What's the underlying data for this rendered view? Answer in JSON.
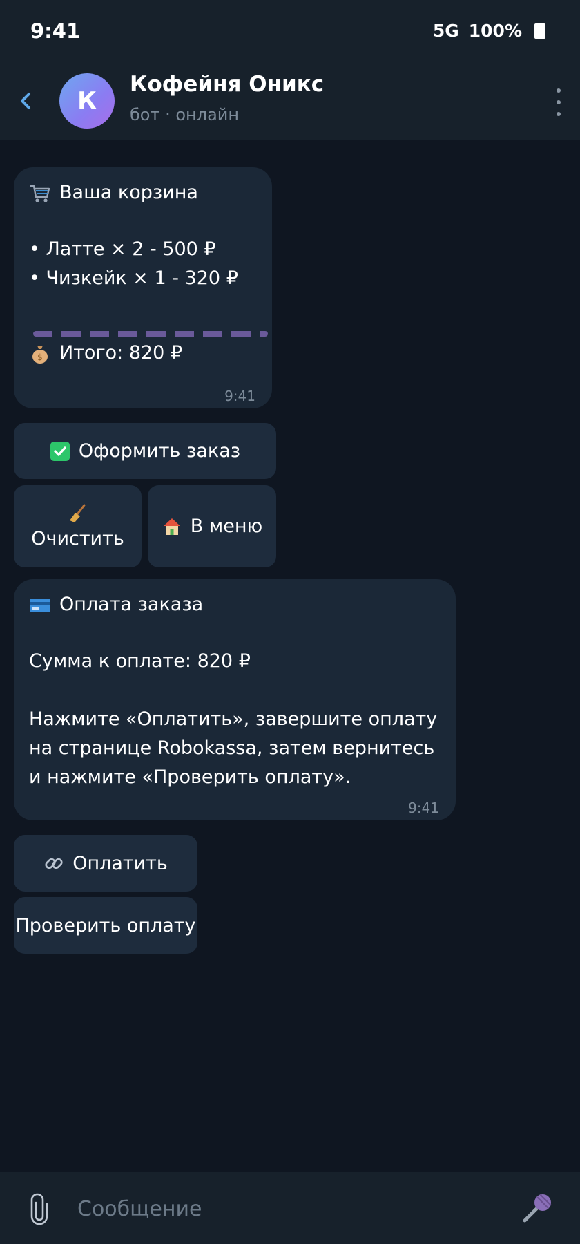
{
  "status": {
    "time": "9:41",
    "network": "5G",
    "battery": "100%"
  },
  "header": {
    "avatar_letter": "К",
    "title": "Кофейня Оникс",
    "subtitle": "бот · онлайн"
  },
  "messages": {
    "cart": {
      "title": "Ваша корзина",
      "items": [
        "• Латте × 2 - 500 ₽",
        "• Чизкейк × 1 - 320 ₽"
      ],
      "total": "Итого: 820 ₽",
      "time": "9:41"
    },
    "payment": {
      "title": "Оплата заказа",
      "amount": "Сумма к оплате: 820 ₽",
      "body": "Нажмите «Оплатить», завершите оплату на странице Robokassa, затем вернитесь и нажмите «Проверить оплату».",
      "time": "9:41"
    }
  },
  "buttons": {
    "checkout": "Оформить заказ",
    "clear": "Очистить",
    "menu": "В меню",
    "pay": "Оплатить",
    "check_payment": "Проверить оплату"
  },
  "composer": {
    "placeholder": "Сообщение"
  },
  "icons": {
    "cart": "shopping-cart-icon",
    "moneybag": "money-bag-icon",
    "check": "check-mark-button-icon",
    "broom": "broom-icon",
    "house": "house-icon",
    "card": "credit-card-icon",
    "link": "link-icon",
    "attach": "paperclip-icon",
    "mic": "microphone-icon"
  },
  "colors": {
    "background": "#0f1621",
    "bar": "#17212b",
    "bubble": "#1b2837",
    "button": "#1e2c3d",
    "accent": "#5fa8e8"
  }
}
